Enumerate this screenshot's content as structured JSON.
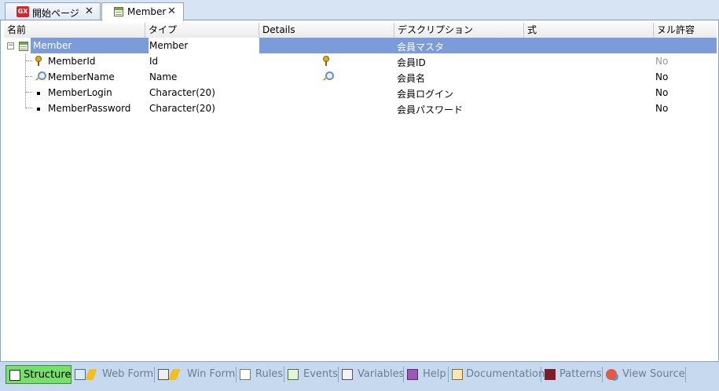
{
  "tabs": [
    {
      "label": "開始ページ",
      "icon": "gx-logo-icon",
      "close": "✕"
    },
    {
      "label": "Member",
      "icon": "transaction-icon",
      "close": "✕"
    }
  ],
  "columns": [
    "名前",
    "タイプ",
    "Details",
    "デスクリプション",
    "式",
    "ヌル許容"
  ],
  "rows": [
    {
      "name": "Member",
      "type": "Member",
      "details": "",
      "description": "会員マスタ",
      "formula": "",
      "nullable": "",
      "icon": "table-icon",
      "selected": true
    },
    {
      "name": "MemberId",
      "type": "Id",
      "details_icon": "key-icon",
      "description": "会員ID",
      "formula": "",
      "nullable": "No",
      "icon": "key-icon"
    },
    {
      "name": "MemberName",
      "type": "Name",
      "details_icon": "search-lens-icon",
      "description": "会員名",
      "formula": "",
      "nullable": "No",
      "icon": "search-lens-icon"
    },
    {
      "name": "MemberLogin",
      "type": "Character(20)",
      "description": "会員ログイン",
      "formula": "",
      "nullable": "No",
      "icon": "bullet-icon"
    },
    {
      "name": "MemberPassword",
      "type": "Character(20)",
      "description": "会員パスワード",
      "formula": "",
      "nullable": "No",
      "icon": "bullet-icon"
    }
  ],
  "bottom_tabs": [
    {
      "label": "Structure",
      "icon": "structure-icon",
      "active": true
    },
    {
      "label": "Web Form",
      "icon": "web-form-icon"
    },
    {
      "label": "Win Form",
      "icon": "win-form-icon"
    },
    {
      "label": "Rules",
      "icon": "rules-icon"
    },
    {
      "label": "Events",
      "icon": "events-icon"
    },
    {
      "label": "Variables",
      "icon": "variables-icon"
    },
    {
      "label": "Help",
      "icon": "help-book-icon"
    },
    {
      "label": "Documentation",
      "icon": "documentation-icon"
    },
    {
      "label": "Patterns",
      "icon": "patterns-icon"
    },
    {
      "label": "View Source",
      "icon": "view-source-icon"
    }
  ],
  "colors": {
    "selected_row": "#7b9bd9",
    "active_tab": "#76e06a",
    "background": "#c7d9ee"
  }
}
